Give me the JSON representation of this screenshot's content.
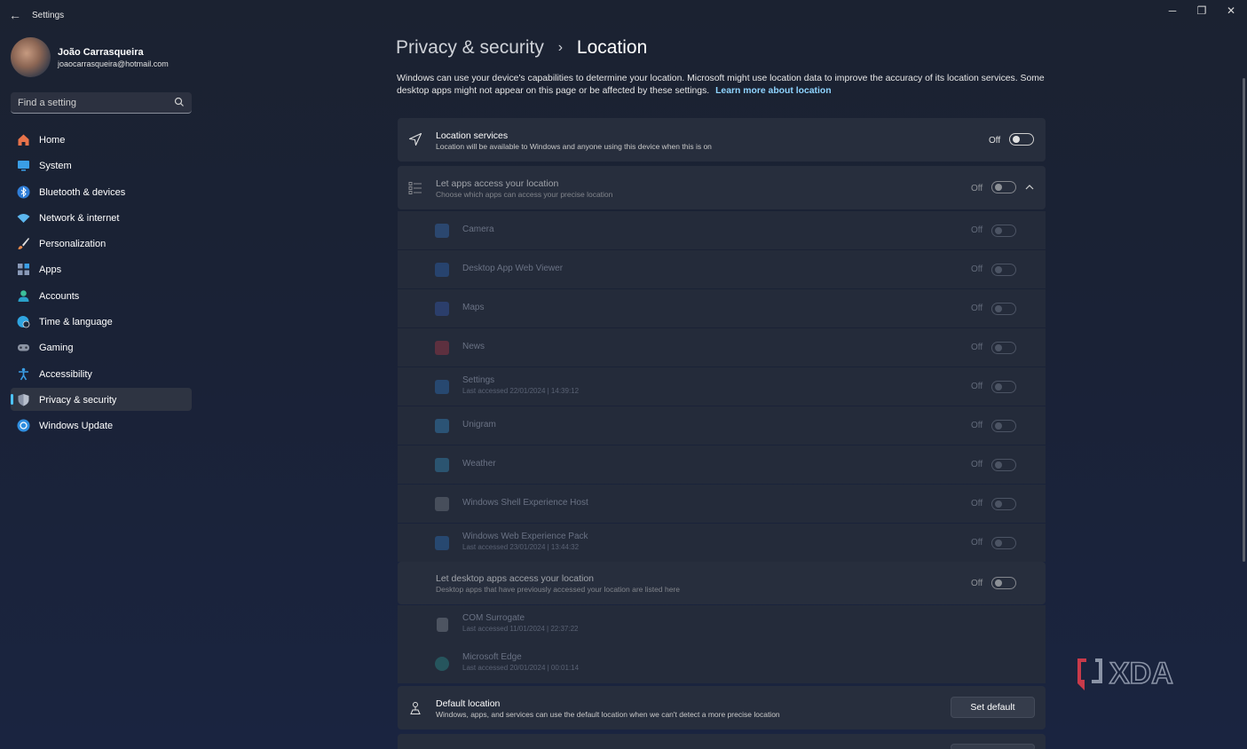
{
  "window": {
    "app_title": "Settings",
    "minimize_glyph": "─",
    "restore_glyph": "❐",
    "close_glyph": "✕",
    "back_glyph": "←"
  },
  "profile": {
    "name": "João Carrasqueira",
    "email": "joaocarrasqueira@hotmail.com"
  },
  "search": {
    "placeholder": "Find a setting",
    "icon": "search-icon"
  },
  "sidebar": {
    "items": [
      {
        "label": "Home",
        "icon": "home-icon",
        "color": "#e8734a"
      },
      {
        "label": "System",
        "icon": "system-icon",
        "color": "#3a9ee6"
      },
      {
        "label": "Bluetooth & devices",
        "icon": "bluetooth-icon",
        "color": "#2f7ed8"
      },
      {
        "label": "Network & internet",
        "icon": "wifi-icon",
        "color": "#5cb6ee"
      },
      {
        "label": "Personalization",
        "icon": "brush-icon",
        "color": "#e8894a"
      },
      {
        "label": "Apps",
        "icon": "apps-icon",
        "color": "#7a8aa8"
      },
      {
        "label": "Accounts",
        "icon": "person-icon",
        "color": "#3bbf9a"
      },
      {
        "label": "Time & language",
        "icon": "globe-clock-icon",
        "color": "#2fa4e0"
      },
      {
        "label": "Gaming",
        "icon": "gamepad-icon",
        "color": "#8c94a4"
      },
      {
        "label": "Accessibility",
        "icon": "accessibility-icon",
        "color": "#3a9ee6"
      },
      {
        "label": "Privacy & security",
        "icon": "shield-icon",
        "color": "#8a93a6",
        "active": true
      },
      {
        "label": "Windows Update",
        "icon": "update-icon",
        "color": "#2f8ee0"
      }
    ]
  },
  "breadcrumb": {
    "parent": "Privacy & security",
    "separator": "›",
    "current": "Location"
  },
  "description": {
    "text": "Windows can use your device's capabilities to determine your location. Microsoft might use location data to improve the accuracy of its location services. Some desktop apps might not appear on this page or be affected by these settings.",
    "link": "Learn more about location"
  },
  "location_services": {
    "title": "Location services",
    "subtitle": "Location will be available to Windows and anyone using this device when this is on",
    "state": "Off"
  },
  "let_apps": {
    "title": "Let apps access your location",
    "subtitle": "Choose which apps can access your precise location",
    "state": "Off"
  },
  "apps": [
    {
      "name": "Camera",
      "sub": "",
      "state": "Off",
      "icon": "camera-icon",
      "color": "#3a7bd5"
    },
    {
      "name": "Desktop App Web Viewer",
      "sub": "",
      "state": "Off",
      "icon": "web-viewer-icon",
      "color": "#2f6fd0"
    },
    {
      "name": "Maps",
      "sub": "",
      "state": "Off",
      "icon": "maps-icon",
      "color": "#3a62c8"
    },
    {
      "name": "News",
      "sub": "",
      "state": "Off",
      "icon": "news-icon",
      "color": "#c83a4a"
    },
    {
      "name": "Settings",
      "sub": "Last accessed 22/01/2024  |  14:39:12",
      "state": "Off",
      "icon": "gear-icon",
      "color": "#2f7ed8"
    },
    {
      "name": "Unigram",
      "sub": "",
      "state": "Off",
      "icon": "telegram-icon",
      "color": "#3a9ee6"
    },
    {
      "name": "Weather",
      "sub": "",
      "state": "Off",
      "icon": "weather-icon",
      "color": "#3aa0d8"
    },
    {
      "name": "Windows Shell Experience Host",
      "sub": "",
      "state": "Off",
      "icon": "window-icon",
      "color": "#8a8f9c"
    },
    {
      "name": "Windows Web Experience Pack",
      "sub": "Last accessed 23/01/2024  |  13:44:32",
      "state": "Off",
      "icon": "widgets-icon",
      "color": "#2f7ed8"
    }
  ],
  "desktop_apps": {
    "title": "Let desktop apps access your location",
    "subtitle": "Desktop apps that have previously accessed your location are listed here",
    "state": "Off"
  },
  "desktop_list": [
    {
      "name": "COM Surrogate",
      "sub": "Last accessed 11/01/2024  |  22:37:22",
      "icon": "file-icon",
      "color": "#9aa0ac"
    },
    {
      "name": "Microsoft Edge",
      "sub": "Last accessed 20/01/2024  |  00:01:14",
      "icon": "edge-icon",
      "color": "#2aa3a0"
    }
  ],
  "default_location": {
    "title": "Default location",
    "subtitle": "Windows, apps, and services can use the default location when we can't detect a more precise location",
    "button": "Set default"
  },
  "watermark": "XDA",
  "colors": {
    "accent": "#4cc2ff",
    "link": "#8fd4ff",
    "card": "#272e3d"
  }
}
